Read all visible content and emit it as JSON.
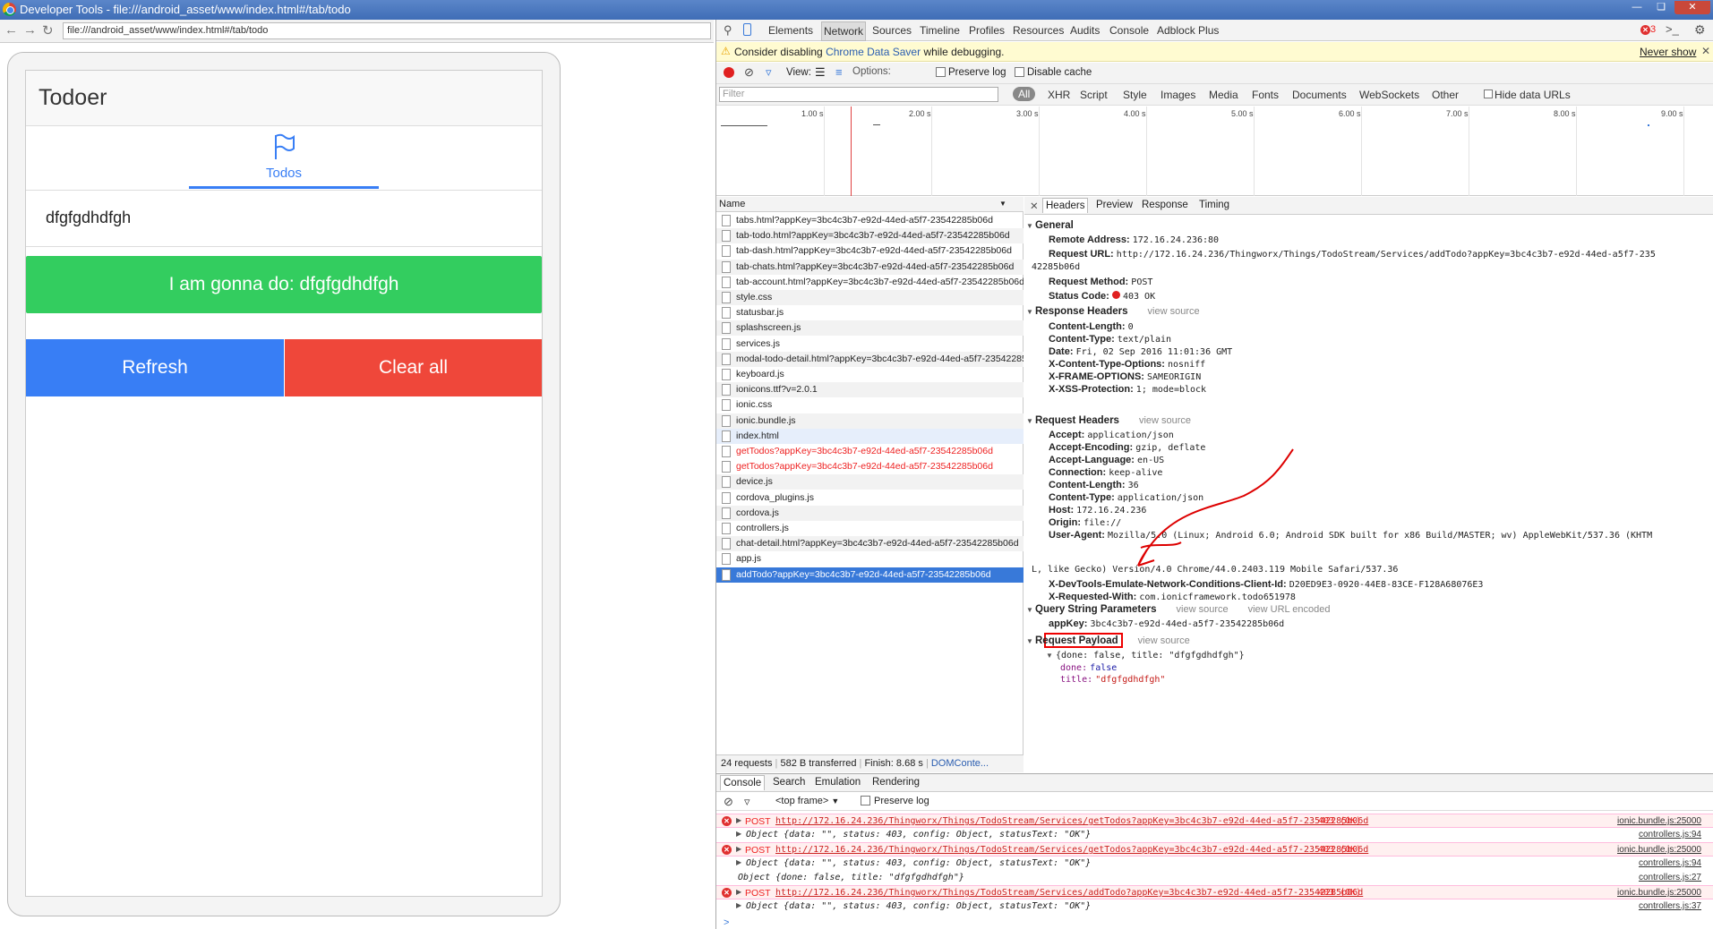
{
  "window": {
    "title": "Developer Tools - file:///android_asset/www/index.html#/tab/todo"
  },
  "browser": {
    "address": "file:///android_asset/www/index.html#/tab/todo"
  },
  "app": {
    "title": "Todoer",
    "tab_label": "Todos",
    "todo_value": "dfgfgdhdfgh",
    "do_button": "I am gonna do: dfgfgdhdfgh",
    "refresh_button": "Refresh",
    "clear_button": "Clear all"
  },
  "devtools": {
    "tabs": [
      "Elements",
      "Network",
      "Sources",
      "Timeline",
      "Profiles",
      "Resources",
      "Audits",
      "Console",
      "Adblock Plus"
    ],
    "error_count": "3",
    "warning": {
      "prefix": "Consider disabling ",
      "link": "Chrome Data Saver",
      "suffix": " while debugging.",
      "dismiss": "Never show"
    },
    "toolbar": {
      "view": "View:",
      "options": "Options:",
      "preserve_log": "Preserve log",
      "disable_cache": "Disable cache"
    },
    "filter": {
      "placeholder": "Filter",
      "types": [
        "All",
        "XHR",
        "Script",
        "Style",
        "Images",
        "Media",
        "Fonts",
        "Documents",
        "WebSockets",
        "Other"
      ],
      "hide_data_urls": "Hide data URLs"
    },
    "timeline_ticks": [
      "1.00 s",
      "2.00 s",
      "3.00 s",
      "4.00 s",
      "5.00 s",
      "6.00 s",
      "7.00 s",
      "8.00 s",
      "9.00 s"
    ],
    "name_header": "Name",
    "requests": [
      {
        "name": "tabs.html?appKey=3bc4c3b7-e92d-44ed-a5f7-23542285b06d",
        "state": "normal"
      },
      {
        "name": "tab-todo.html?appKey=3bc4c3b7-e92d-44ed-a5f7-23542285b06d",
        "state": "normal"
      },
      {
        "name": "tab-dash.html?appKey=3bc4c3b7-e92d-44ed-a5f7-23542285b06d",
        "state": "normal"
      },
      {
        "name": "tab-chats.html?appKey=3bc4c3b7-e92d-44ed-a5f7-23542285b06d",
        "state": "normal"
      },
      {
        "name": "tab-account.html?appKey=3bc4c3b7-e92d-44ed-a5f7-23542285b06d",
        "state": "normal"
      },
      {
        "name": "style.css",
        "state": "normal"
      },
      {
        "name": "statusbar.js",
        "state": "normal"
      },
      {
        "name": "splashscreen.js",
        "state": "normal"
      },
      {
        "name": "services.js",
        "state": "normal"
      },
      {
        "name": "modal-todo-detail.html?appKey=3bc4c3b7-e92d-44ed-a5f7-23542285b06d",
        "state": "normal"
      },
      {
        "name": "keyboard.js",
        "state": "normal"
      },
      {
        "name": "ionicons.ttf?v=2.0.1",
        "state": "normal"
      },
      {
        "name": "ionic.css",
        "state": "normal"
      },
      {
        "name": "ionic.bundle.js",
        "state": "normal"
      },
      {
        "name": "index.html",
        "state": "hl"
      },
      {
        "name": "getTodos?appKey=3bc4c3b7-e92d-44ed-a5f7-23542285b06d",
        "state": "err"
      },
      {
        "name": "getTodos?appKey=3bc4c3b7-e92d-44ed-a5f7-23542285b06d",
        "state": "err"
      },
      {
        "name": "device.js",
        "state": "normal"
      },
      {
        "name": "cordova_plugins.js",
        "state": "normal"
      },
      {
        "name": "cordova.js",
        "state": "normal"
      },
      {
        "name": "controllers.js",
        "state": "normal"
      },
      {
        "name": "chat-detail.html?appKey=3bc4c3b7-e92d-44ed-a5f7-23542285b06d",
        "state": "normal"
      },
      {
        "name": "app.js",
        "state": "normal"
      },
      {
        "name": "addTodo?appKey=3bc4c3b7-e92d-44ed-a5f7-23542285b06d",
        "state": "sel"
      }
    ],
    "status_bar": {
      "requests": "24 requests",
      "transferred": "582 B transferred",
      "finish": "Finish: 8.68 s",
      "dom": "DOMConte..."
    },
    "detail_tabs": [
      "Headers",
      "Preview",
      "Response",
      "Timing"
    ],
    "general": {
      "title": "General",
      "remote_address": "172.16.24.236:80",
      "request_url": "http://172.16.24.236/Thingworx/Things/TodoStream/Services/addTodo?appKey=3bc4c3b7-e92d-44ed-a5f7-235",
      "request_url_tail": "42285b06d",
      "request_method": "POST",
      "status_code": "403 OK"
    },
    "response_headers": {
      "title": "Response Headers",
      "view_source": "view source",
      "items": [
        {
          "k": "Content-Length:",
          "v": "0"
        },
        {
          "k": "Content-Type:",
          "v": "text/plain"
        },
        {
          "k": "Date:",
          "v": "Fri, 02 Sep 2016 11:01:36 GMT"
        },
        {
          "k": "X-Content-Type-Options:",
          "v": "nosniff"
        },
        {
          "k": "X-FRAME-OPTIONS:",
          "v": "SAMEORIGIN"
        },
        {
          "k": "X-XSS-Protection:",
          "v": "1; mode=block"
        }
      ]
    },
    "request_headers": {
      "title": "Request Headers",
      "view_source": "view source",
      "items": [
        {
          "k": "Accept:",
          "v": "application/json"
        },
        {
          "k": "Accept-Encoding:",
          "v": "gzip, deflate"
        },
        {
          "k": "Accept-Language:",
          "v": "en-US"
        },
        {
          "k": "Connection:",
          "v": "keep-alive"
        },
        {
          "k": "Content-Length:",
          "v": "36"
        },
        {
          "k": "Content-Type:",
          "v": "application/json"
        },
        {
          "k": "Host:",
          "v": "172.16.24.236"
        },
        {
          "k": "Origin:",
          "v": "file://"
        },
        {
          "k": "User-Agent:",
          "v": "Mozilla/5.0 (Linux; Android 6.0; Android SDK built for x86 Build/MASTER; wv) AppleWebKit/537.36 (KHTM"
        }
      ],
      "ua_tail": "L, like Gecko) Version/4.0 Chrome/44.0.2403.119 Mobile Safari/537.36",
      "items2": [
        {
          "k": "X-DevTools-Emulate-Network-Conditions-Client-Id:",
          "v": "D20ED9E3-0920-44E8-83CE-F128A68076E3"
        },
        {
          "k": "X-Requested-With:",
          "v": "com.ionicframework.todo651978"
        }
      ]
    },
    "query": {
      "title": "Query String Parameters",
      "view_source": "view source",
      "view_url_encoded": "view URL encoded",
      "k": "appKey:",
      "v": "3bc4c3b7-e92d-44ed-a5f7-23542285b06d"
    },
    "payload": {
      "title": "Request Payload",
      "view_source": "view source",
      "summary": "{done: false, title: \"dfgfgdhdfgh\"}",
      "done_k": "done:",
      "done_v": "false",
      "title_k": "title:",
      "title_v": "\"dfgfgdhdfgh\""
    },
    "drawer_tabs": [
      "Console",
      "Search",
      "Emulation",
      "Rendering"
    ],
    "console_bar": {
      "frame": "<top frame>",
      "preserve_log": "Preserve log"
    },
    "console": [
      {
        "type": "err",
        "method": "POST",
        "url": "http://172.16.24.236/Thingworx/Things/TodoStream/Services/getTodos?appKey=3bc4c3b7-e92d-44ed-a5f7-23542285b06d",
        "status": "403 (OK)",
        "src": "ionic.bundle.js:25000"
      },
      {
        "type": "obj",
        "text": "Object {data: \"\", status: 403, config: Object, statusText: \"OK\"}",
        "src": "controllers.js:94"
      },
      {
        "type": "err",
        "method": "POST",
        "url": "http://172.16.24.236/Thingworx/Things/TodoStream/Services/getTodos?appKey=3bc4c3b7-e92d-44ed-a5f7-23542285b06d",
        "status": "403 (OK)",
        "src": "ionic.bundle.js:25000"
      },
      {
        "type": "obj",
        "text": "Object {data: \"\", status: 403, config: Object, statusText: \"OK\"}",
        "src": "controllers.js:94"
      },
      {
        "type": "plain",
        "text": "Object {done: false, title: \"dfgfgdhdfgh\"}",
        "src": "controllers.js:27"
      },
      {
        "type": "err",
        "method": "POST",
        "url": "http://172.16.24.236/Thingworx/Things/TodoStream/Services/addTodo?appKey=3bc4c3b7-e92d-44ed-a5f7-23542285b06d",
        "status": "403 (OK)",
        "src": "ionic.bundle.js:25000"
      },
      {
        "type": "obj",
        "text": "Object {data: \"\", status: 403, config: Object, statusText: \"OK\"}",
        "src": "controllers.js:37"
      }
    ],
    "colors": {
      "accent": "#3879d9",
      "error": "#e22222",
      "ionic_green": "#33cd5f",
      "ionic_blue": "#387ef5",
      "ionic_red": "#ef473a"
    }
  }
}
